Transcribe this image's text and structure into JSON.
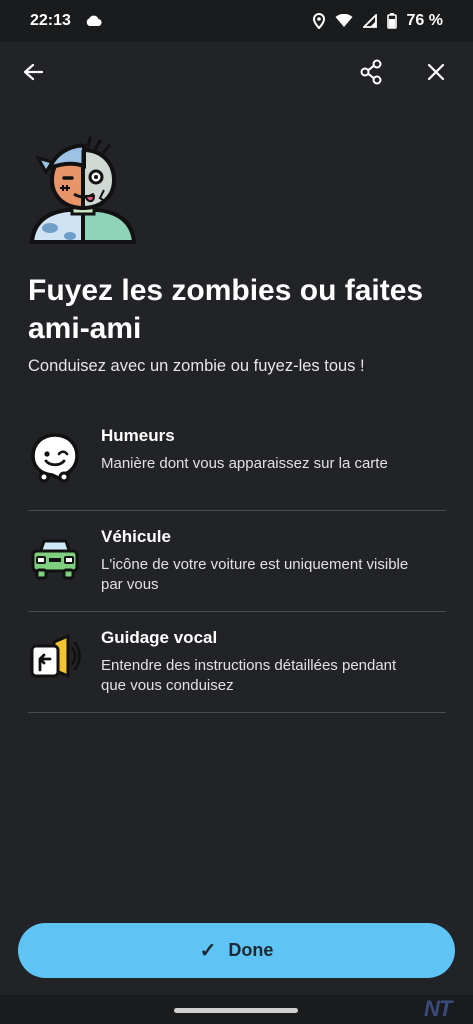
{
  "status_bar": {
    "time": "22:13",
    "battery": "76 %",
    "icons": [
      "cloud-icon",
      "location-icon",
      "wifi-icon",
      "signal-icon",
      "battery-icon"
    ]
  },
  "nav": {
    "icons": [
      "back-arrow-icon",
      "share-icon",
      "close-icon"
    ]
  },
  "title": "Fuyez les zombies ou faites ami-ami",
  "subtitle": "Conduisez avec un zombie ou fuyez-les tous !",
  "features": [
    {
      "icon": "waze-mood-icon",
      "title": "Humeurs",
      "desc": "Manière dont vous apparaissez sur la carte"
    },
    {
      "icon": "car-icon",
      "title": "Véhicule",
      "desc": "L'icône de votre voiture est uniquement visible par vous"
    },
    {
      "icon": "voice-guidance-icon",
      "title": "Guidage vocal",
      "desc": "Entendre des instructions détaillées pendant que vous conduisez"
    }
  ],
  "done_button": {
    "check": "✓",
    "label": "Done"
  },
  "watermark": "NT",
  "colors": {
    "background": "#222326",
    "accent": "#5ec3f5",
    "divider": "#4a4b4e"
  }
}
